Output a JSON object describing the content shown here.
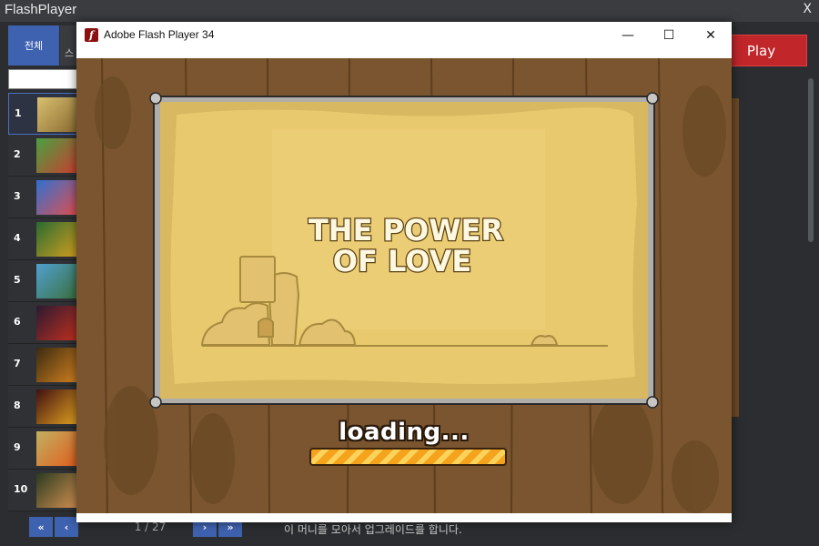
{
  "app": {
    "title": "FlashPlayer",
    "close_glyph": "X"
  },
  "tabs": {
    "all_label": "전체",
    "second_label": "스"
  },
  "search": {
    "placeholder": ""
  },
  "games": [
    {
      "num": "1",
      "colors": [
        "#d8c070",
        "#8a6a30"
      ]
    },
    {
      "num": "2",
      "colors": [
        "#4aa040",
        "#c84030"
      ]
    },
    {
      "num": "3",
      "colors": [
        "#3070d0",
        "#e05050"
      ]
    },
    {
      "num": "4",
      "colors": [
        "#2a6a30",
        "#d0a020"
      ]
    },
    {
      "num": "5",
      "colors": [
        "#50a0d0",
        "#3a7040"
      ]
    },
    {
      "num": "6",
      "colors": [
        "#2a1a30",
        "#c03020"
      ]
    },
    {
      "num": "7",
      "colors": [
        "#3a2a10",
        "#d08020"
      ]
    },
    {
      "num": "8",
      "colors": [
        "#401010",
        "#e0a020"
      ]
    },
    {
      "num": "9",
      "colors": [
        "#c0b060",
        "#e06020"
      ]
    },
    {
      "num": "10",
      "colors": [
        "#2a3a20",
        "#d09050"
      ]
    }
  ],
  "pager": {
    "first": "«",
    "prev": "‹",
    "text": "1 / 27",
    "next": "›",
    "last": "»"
  },
  "play_button": "Play",
  "status_text": "이 머니를 모아서 업그레이드를 합니다.",
  "flash_window": {
    "title": "Adobe Flash Player 34",
    "minimize": "—",
    "maximize": "☐",
    "close": "✕",
    "icon_glyph": "f"
  },
  "game_screen": {
    "title_line1": "THE POWER",
    "title_line2": "OF LOVE",
    "loading": "loading...",
    "progress": 1.0
  },
  "colors": {
    "accent_blue": "#3f62b0",
    "play_red": "#c0262a",
    "wood": "#7a5530",
    "parchment": "#e9c96d"
  }
}
